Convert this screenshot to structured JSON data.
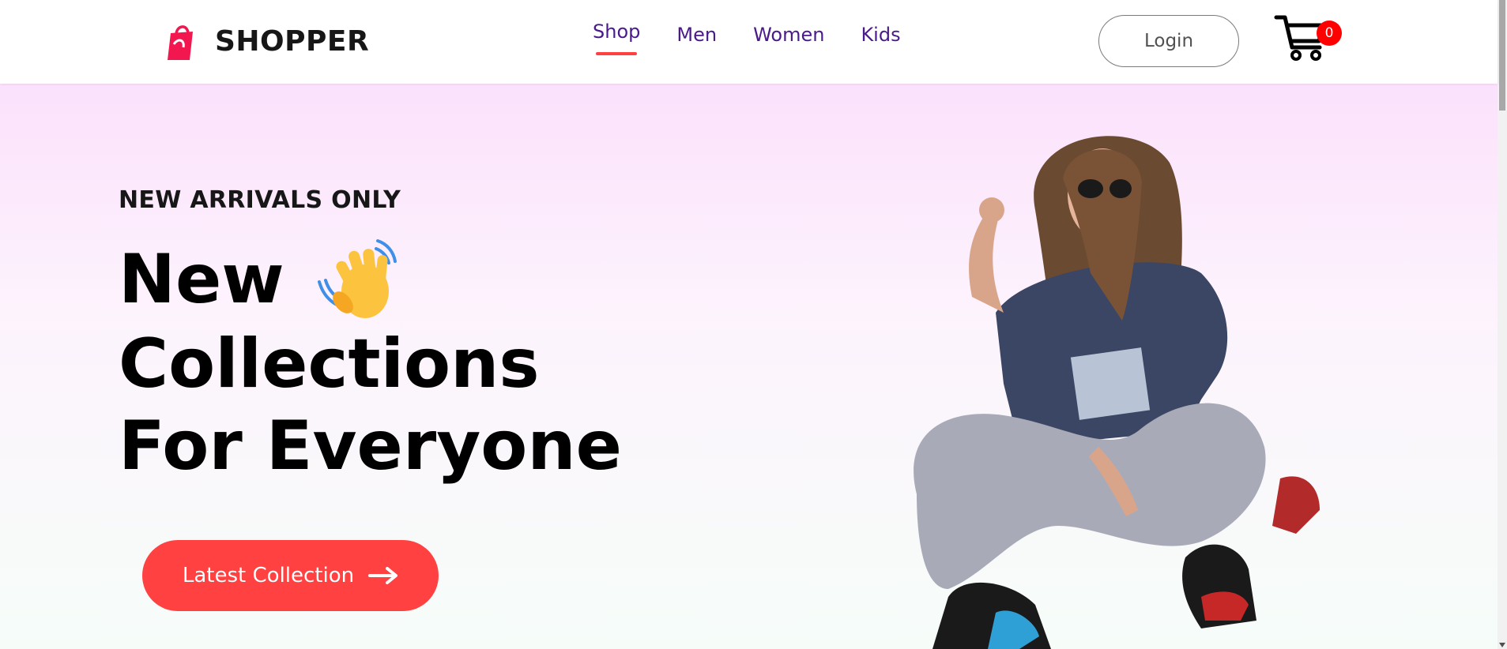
{
  "brand": {
    "name": "SHOPPER",
    "logo_icon": "shopping-bag-icon"
  },
  "nav": {
    "items": [
      {
        "label": "Shop",
        "active": true
      },
      {
        "label": "Men",
        "active": false
      },
      {
        "label": "Women",
        "active": false
      },
      {
        "label": "Kids",
        "active": false
      }
    ]
  },
  "header": {
    "login_label": "Login",
    "cart_count": "0",
    "cart_icon": "cart-icon"
  },
  "hero": {
    "eyebrow": "NEW ARRIVALS ONLY",
    "title_lines": [
      "New",
      "Collections",
      "For Everyone"
    ],
    "hand_icon": "waving-hand-icon",
    "cta_label": "Latest Collection",
    "cta_icon": "arrow-right-icon"
  },
  "colors": {
    "accent": "#ff4141",
    "nav_text": "#4a1a8c",
    "badge": "#ff0000",
    "hero_top": "#fbe1fc",
    "hero_bottom": "#f6fdf9"
  }
}
